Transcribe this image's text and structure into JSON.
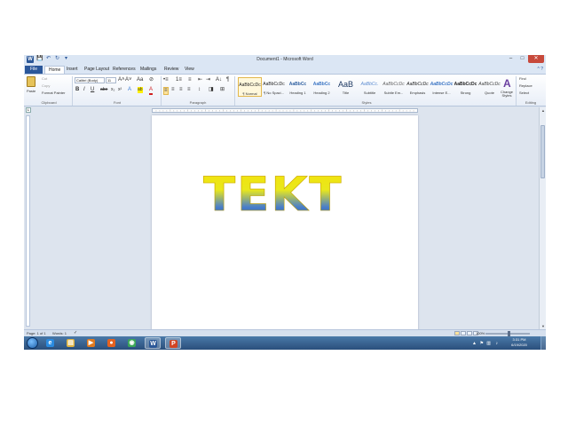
{
  "window": {
    "title": "Document1 - Microsoft Word",
    "minimize": "–",
    "maximize": "□",
    "close": "✕"
  },
  "qat": {
    "save": "💾",
    "undo": "↶",
    "redo": "↻",
    "more": "▾",
    "logo": "W"
  },
  "tabs": [
    "File",
    "Home",
    "Insert",
    "Page Layout",
    "References",
    "Mailings",
    "Review",
    "View"
  ],
  "active_tab": "Home",
  "help": "^ ?",
  "ribbon": {
    "clipboard": {
      "label": "Clipboard",
      "paste": "Paste",
      "cut": "Cut",
      "copy": "Copy",
      "format_painter": "Format Painter"
    },
    "font": {
      "label": "Font",
      "font_name": "Calibri (Body)",
      "font_size": "11",
      "grow": "A˄",
      "shrink": "A˅",
      "case": "Aa",
      "clear": "⊘",
      "bold": "B",
      "italic": "I",
      "underline": "U",
      "strike": "abe",
      "subscript": "x₂",
      "superscript": "x²",
      "effects": "A",
      "highlight": "ab",
      "color": "A"
    },
    "paragraph": {
      "label": "Paragraph",
      "bullets": "•≡",
      "numbering": "1≡",
      "multilevel": "≡",
      "decrease_indent": "⇤",
      "increase_indent": "⇥",
      "sort": "A↓",
      "pilcrow": "¶",
      "align_left": "≡",
      "center": "≡",
      "align_right": "≡",
      "justify": "≡",
      "spacing": "↕",
      "shading": "◨",
      "borders": "⊞"
    },
    "styles": {
      "label": "Styles",
      "items": [
        {
          "preview": "AaBbCcDc",
          "name": "¶ Normal"
        },
        {
          "preview": "AaBbCcDc",
          "name": "¶ No Spaci..."
        },
        {
          "preview": "AaBbCc",
          "name": "Heading 1"
        },
        {
          "preview": "AaBbCc",
          "name": "Heading 2"
        },
        {
          "preview": "AaB",
          "name": "Title"
        },
        {
          "preview": "AaBbCc.",
          "name": "Subtitle"
        },
        {
          "preview": "AaBbCcDc",
          "name": "Subtle Em..."
        },
        {
          "preview": "AaBbCcDc",
          "name": "Emphasis"
        },
        {
          "preview": "AaBbCcDc",
          "name": "Intense E..."
        },
        {
          "preview": "AaBbCcDc",
          "name": "Strong"
        },
        {
          "preview": "AaBbCcDc",
          "name": "Quote"
        }
      ],
      "change_styles": "Change Styles"
    },
    "editing": {
      "label": "Editing",
      "find": "Find",
      "replace": "Replace",
      "select": "Select"
    }
  },
  "document": {
    "text": "TEKT"
  },
  "status": {
    "page": "Page: 1 of 1",
    "words": "Words: 1",
    "zoom": "100%",
    "zoom_level": 0.5
  },
  "taskbar": {
    "items": [
      {
        "name": "ie",
        "glyph": "e",
        "color": "#2a8be0",
        "active": false
      },
      {
        "name": "explorer",
        "glyph": "▤",
        "color": "#e0b442",
        "active": false
      },
      {
        "name": "media-player",
        "glyph": "▶",
        "color": "#e07a1f",
        "active": false
      },
      {
        "name": "firefox",
        "glyph": "●",
        "color": "#e5611f",
        "active": false
      },
      {
        "name": "chrome",
        "glyph": "◉",
        "color": "#3aa757",
        "active": false
      },
      {
        "name": "word",
        "glyph": "W",
        "color": "#2b5797",
        "active": true
      },
      {
        "name": "powerpoint",
        "glyph": "P",
        "color": "#d04423",
        "active": true
      }
    ],
    "time": "3:31 PM",
    "date": "6/19/2020"
  },
  "colors": {
    "accent": "#2b579a",
    "title_gradient_top": "#f4e10a",
    "title_gradient_bottom": "#1f4fb0"
  }
}
